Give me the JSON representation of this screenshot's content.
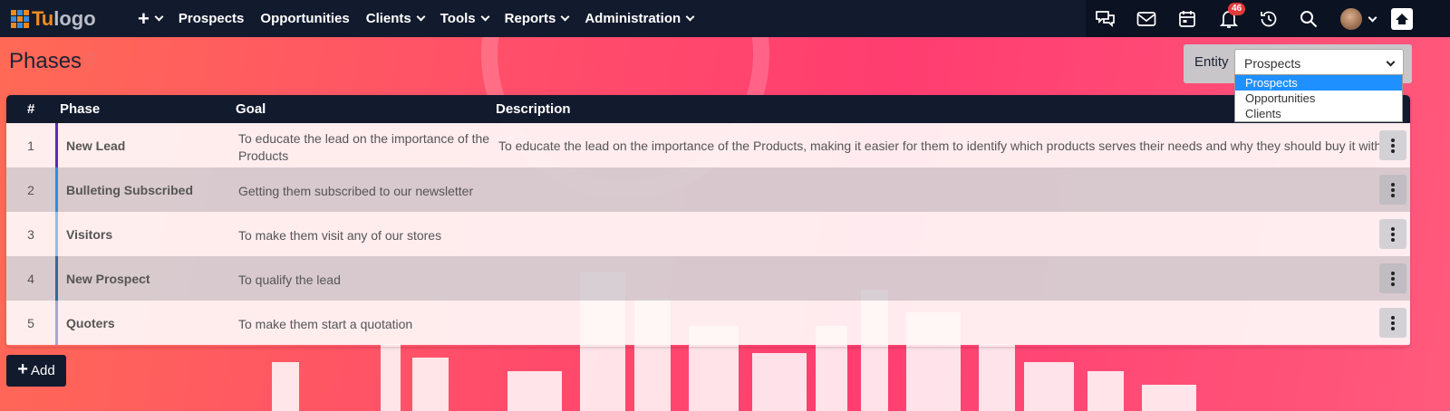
{
  "navbar": {
    "logo": {
      "brand_mark": "Tu",
      "brand_text": "logo"
    },
    "add_menu_icon": "plus-icon",
    "menu": [
      {
        "label": "Prospects",
        "has_dropdown": false
      },
      {
        "label": "Opportunities",
        "has_dropdown": false
      },
      {
        "label": "Clients",
        "has_dropdown": true
      },
      {
        "label": "Tools",
        "has_dropdown": true
      },
      {
        "label": "Reports",
        "has_dropdown": true
      },
      {
        "label": "Administration",
        "has_dropdown": true
      }
    ],
    "icons": [
      "chat-icon",
      "mail-icon",
      "calendar-icon",
      "bell-icon",
      "history-icon",
      "search-icon",
      "avatar",
      "home-icon"
    ],
    "notification_count": "46"
  },
  "page": {
    "title": "Phases",
    "help_icon": "help-icon"
  },
  "entity": {
    "label": "Entity",
    "selected": "Prospects",
    "options": [
      "Prospects",
      "Opportunities",
      "Clients"
    ],
    "highlighted_option": "Prospects"
  },
  "table": {
    "columns": {
      "num": "#",
      "phase": "Phase",
      "goal": "Goal",
      "description": "Description"
    },
    "rows": [
      {
        "num": "1",
        "phase": "New Lead",
        "goal": "To educate the lead on the importance of the Products",
        "description": "To educate the lead on the importance of the Products, making it easier for them to identify which products serves their needs and why they should buy it with us",
        "color": "#5b2bb8"
      },
      {
        "num": "2",
        "phase": "Bulleting Subscribed",
        "goal": "Getting them subscribed to our newsletter",
        "description": "",
        "color": "#2d8ee0"
      },
      {
        "num": "3",
        "phase": "Visitors",
        "goal": "To make them visit any of our stores",
        "description": "",
        "color": "#8cbff0"
      },
      {
        "num": "4",
        "phase": "New Prospect",
        "goal": "To qualify the lead",
        "description": "",
        "color": "#2b6aa8"
      },
      {
        "num": "5",
        "phase": "Quoters",
        "goal": "To make them start a quotation",
        "description": "",
        "color": "#a9a4d6"
      }
    ],
    "row_action_icon": "kebab-menu-icon"
  },
  "add_button": {
    "label": "Add",
    "icon": "plus-icon"
  },
  "colors": {
    "navbar": "#121a2e",
    "accent_orange": "#f08a1c",
    "badge": "#e43a3a",
    "select_highlight": "#1e90ff"
  }
}
